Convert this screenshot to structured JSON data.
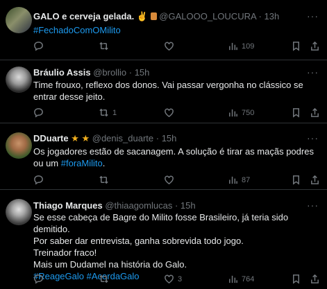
{
  "tweets": [
    {
      "name": "GALO e cerveja gelada.",
      "emoji": "✌",
      "handle": "@GALOOO_LOUCURA",
      "time": "· 13h",
      "text1": "",
      "hashtag1": "#FechadoComOMilito",
      "counts": {
        "reply": "",
        "retweet": "",
        "like": "",
        "views": "109"
      }
    },
    {
      "name": "Bráulio Assis",
      "handle": "@brollio",
      "time": "· 15h",
      "text1": "Time frouxo, reflexo dos donos. Vai passar vergonha no clássico se entrar desse jeito.",
      "counts": {
        "reply": "",
        "retweet": "1",
        "like": "",
        "views": "750"
      }
    },
    {
      "name": "DDuarte",
      "stars": "★ ★",
      "handle": "@denis_duarte",
      "time": "· 15h",
      "text1": "Os jogadores estão de sacanagem. A solução é tirar as maçãs podres ou um ",
      "hashtag1": "#foraMilito",
      "text2": ".",
      "counts": {
        "reply": "",
        "retweet": "",
        "like": "",
        "views": "87"
      }
    },
    {
      "name": "Thiago Marques",
      "handle": "@thiaagomlucas",
      "time": "· 15h",
      "lines": [
        "Se esse cabeça de Bagre do Milito fosse Brasileiro, já teria sido demitido.",
        "Por saber dar entrevista, ganha sobrevida todo jogo.",
        "Treinador fraco!",
        "Mais um Dudamel na história do Galo."
      ],
      "hashtag1": "#ReageGalo",
      "hashtag2": "#AcordaGalo",
      "counts": {
        "reply": "",
        "retweet": "",
        "like": "3",
        "views": "764"
      }
    }
  ],
  "more_label": "···"
}
